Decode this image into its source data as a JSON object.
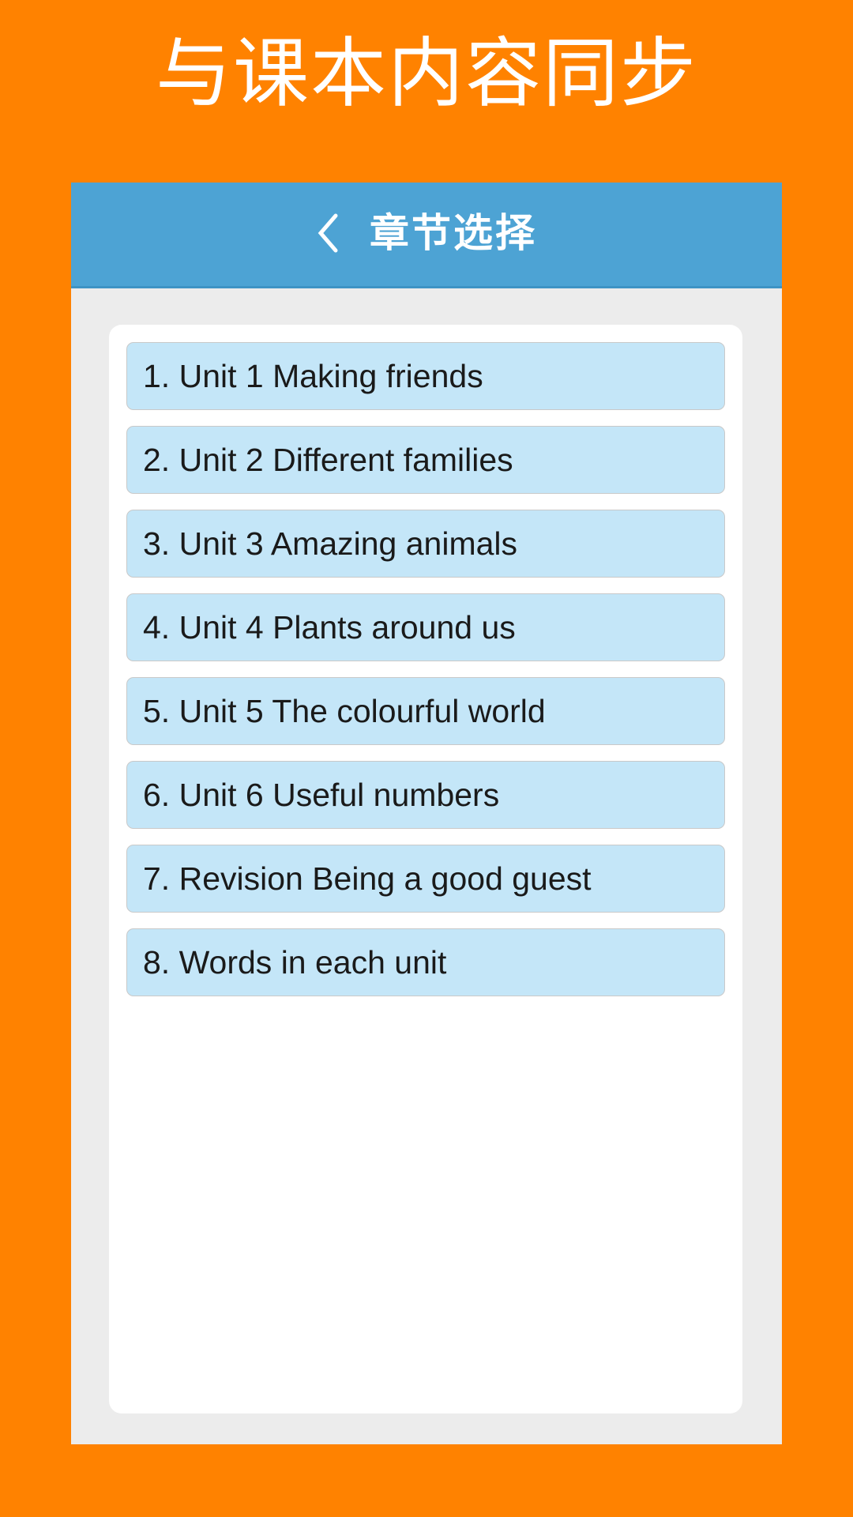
{
  "promo": {
    "headline": "与课本内容同步"
  },
  "nav": {
    "back_icon": "chevron-left-icon",
    "title": "章节选择"
  },
  "chapters": [
    {
      "label": "1. Unit 1 Making friends"
    },
    {
      "label": "2. Unit 2 Different families"
    },
    {
      "label": "3. Unit 3 Amazing animals"
    },
    {
      "label": "4. Unit 4 Plants around us"
    },
    {
      "label": "5. Unit 5 The colourful world"
    },
    {
      "label": "6. Unit 6 Useful numbers"
    },
    {
      "label": "7. Revision Being a good guest"
    },
    {
      "label": "8. Words in each unit"
    }
  ],
  "colors": {
    "background_orange": "#FF8200",
    "nav_blue": "#4DA3D4",
    "panel_gray": "#ECECEC",
    "card_white": "#FFFFFF",
    "item_blue": "#C4E6F8",
    "item_border": "#C9C9C9",
    "text_dark": "#1A1A1A",
    "text_white": "#FFFFFF"
  }
}
